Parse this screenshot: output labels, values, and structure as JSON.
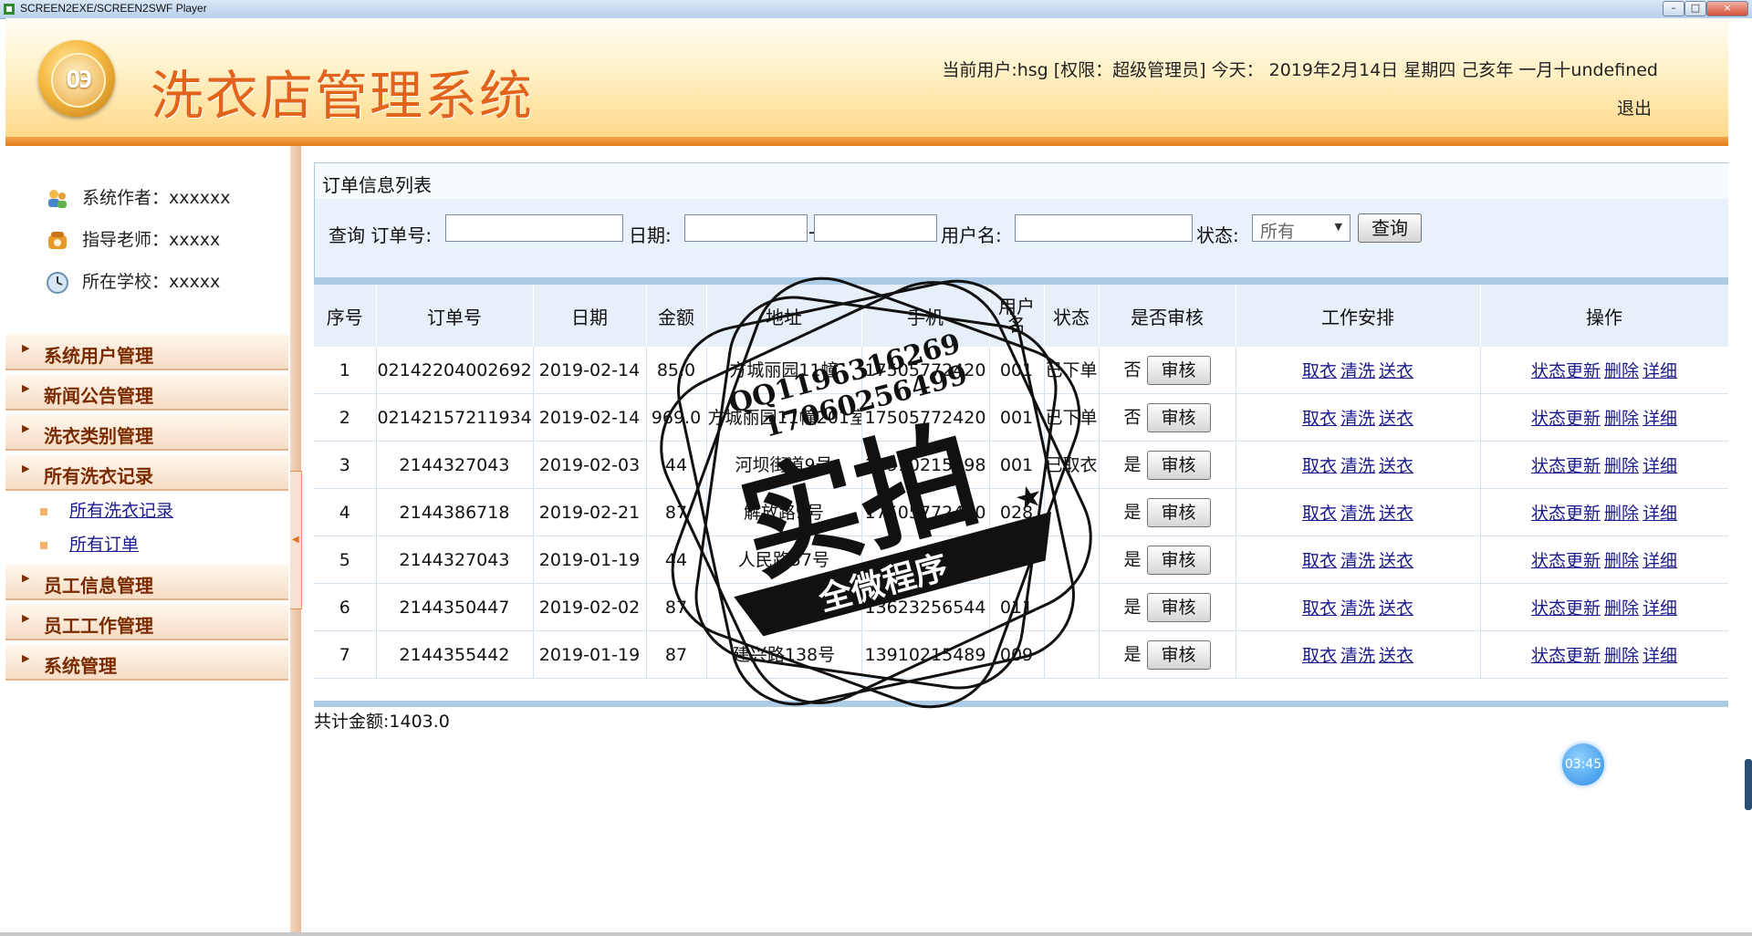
{
  "window": {
    "title": "SCREEN2EXE/SCREEN2SWF Player",
    "min": "–",
    "max": "□",
    "close": "×"
  },
  "header": {
    "app_title": "洗衣店管理系统",
    "user_info": "当前用户:hsg [权限：超级管理员] 今天： 2019年2月14日 星期四 己亥年 一月十undefined",
    "logout": "退出"
  },
  "sidebar": {
    "info": [
      {
        "label": "系统作者：xxxxxx",
        "icon": "users-icon"
      },
      {
        "label": "指导老师：xxxxx",
        "icon": "phone-icon"
      },
      {
        "label": "所在学校：xxxxx",
        "icon": "clock-icon"
      }
    ],
    "menu": [
      {
        "label": "系统用户管理"
      },
      {
        "label": "新闻公告管理"
      },
      {
        "label": "洗衣类别管理"
      },
      {
        "label": "所有洗衣记录",
        "children": [
          "所有洗衣记录",
          "所有订单"
        ]
      },
      {
        "label": "员工信息管理"
      },
      {
        "label": "员工工作管理"
      },
      {
        "label": "系统管理"
      }
    ]
  },
  "panel": {
    "title": "订单信息列表"
  },
  "search": {
    "order_label": "查询 订单号:",
    "date_label": "日期:",
    "date_sep": "-",
    "user_label": "用户名:",
    "status_label": "状态:",
    "status_value": "所有",
    "query_button": "查询"
  },
  "table": {
    "headers": [
      "序号",
      "订单号",
      "日期",
      "金额",
      "地址",
      "手机",
      "用户名",
      "状态",
      "是否审核",
      "工作安排",
      "操作"
    ],
    "audit_button": "审核",
    "work_links": [
      "取衣",
      "清洗",
      "送衣"
    ],
    "op_links": [
      "状态更新",
      "删除",
      "详细"
    ],
    "rows": [
      {
        "no": "1",
        "order": "02142204002692",
        "date": "2019-02-14",
        "amount": "85.0",
        "addr": "方城丽园11幢",
        "phone": "17505772420",
        "user": "001",
        "status": "已下单",
        "audited": "否"
      },
      {
        "no": "2",
        "order": "02142157211934",
        "date": "2019-02-14",
        "amount": "969.0",
        "addr": "方城丽园11幢201室",
        "phone": "17505772420",
        "user": "001",
        "status": "已下单",
        "audited": "否"
      },
      {
        "no": "3",
        "order": "2144327043",
        "date": "2019-02-03",
        "amount": "44",
        "addr": "河坝街道9号",
        "phone": "13910215998",
        "user": "001",
        "status": "已取衣",
        "audited": "是"
      },
      {
        "no": "4",
        "order": "2144386718",
        "date": "2019-02-21",
        "amount": "87",
        "addr": "解放路9号",
        "phone": "17505772420",
        "user": "028",
        "status": "",
        "audited": "是"
      },
      {
        "no": "5",
        "order": "2144327043",
        "date": "2019-01-19",
        "amount": "44",
        "addr": "人民路57号",
        "phone": "",
        "user": "027",
        "status": "",
        "audited": "是"
      },
      {
        "no": "6",
        "order": "2144350447",
        "date": "2019-02-02",
        "amount": "87",
        "addr": "上江小区",
        "phone": "13623256544",
        "user": "011",
        "status": "",
        "audited": "是"
      },
      {
        "no": "7",
        "order": "2144355442",
        "date": "2019-01-19",
        "amount": "87",
        "addr": "建兴路138号",
        "phone": "13910215489",
        "user": "009",
        "status": "",
        "audited": "是"
      }
    ]
  },
  "footer": {
    "total": "共计金额:1403.0"
  },
  "timer": "03:45",
  "stamp": {
    "qq": "QQ1196316269",
    "phone": "17060256499",
    "main": "实拍",
    "ribbon": "全微程序"
  }
}
